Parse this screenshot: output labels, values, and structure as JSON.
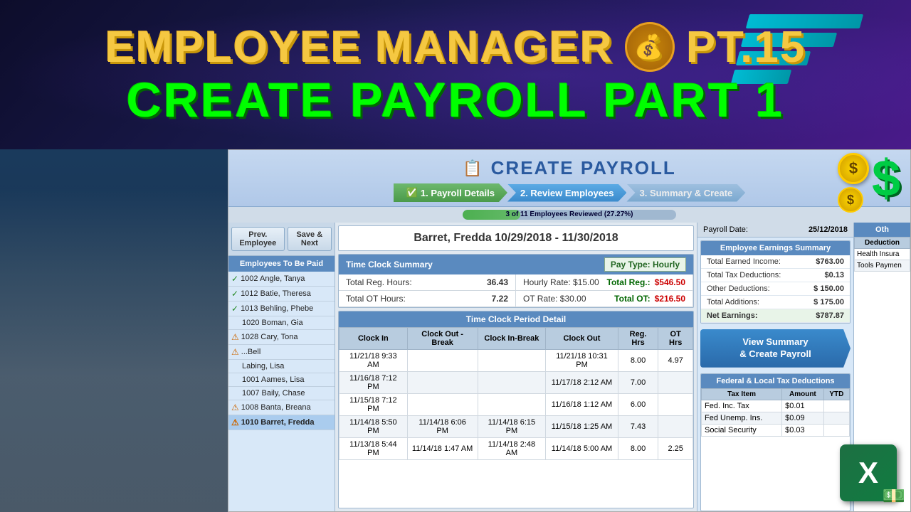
{
  "header": {
    "title_line1": "EMPLOYEE MANAGER",
    "title_pt": "PT.15",
    "title_line2": "CREATE PAYROLL PART 1"
  },
  "app": {
    "title": "CREATE PAYROLL",
    "steps": [
      {
        "label": "1. Payroll Details",
        "state": "completed"
      },
      {
        "label": "2. Review Employees",
        "state": "active"
      },
      {
        "label": "3. Summary & Create",
        "state": "inactive"
      }
    ],
    "progress": {
      "text": "3 of 11 Employees Reviewed (27.27%)",
      "percent": 27
    },
    "nav": {
      "prev_btn": "Prev. Employee",
      "next_btn": "Save & Next"
    },
    "current_employee": {
      "header": "Barret, Fredda  10/29/2018 - 11/30/2018"
    },
    "employees_panel_title": "Employees To Be Paid",
    "employees": [
      {
        "id": "1002",
        "name": "Angle, Tanya",
        "status": "check"
      },
      {
        "id": "1012",
        "name": "Batie, Theresa",
        "status": "check"
      },
      {
        "id": "1013",
        "name": "Behling, Phebe",
        "status": "check"
      },
      {
        "id": "1020",
        "name": "Boman, Gia",
        "status": "none"
      },
      {
        "id": "1028",
        "name": "Cary, Tona",
        "status": "warn"
      },
      {
        "id": "",
        "name": "...Bell",
        "status": "warn"
      },
      {
        "id": "",
        "name": "Labing, Lisa",
        "status": "none"
      },
      {
        "id": "1001",
        "name": "Aames, Lisa",
        "status": "none"
      },
      {
        "id": "1007",
        "name": "Baily, Chase",
        "status": "none"
      },
      {
        "id": "1008",
        "name": "Banta, Breana",
        "status": "warn"
      },
      {
        "id": "1010",
        "name": "Barret, Fredda",
        "status": "warn",
        "selected": true
      }
    ],
    "payroll_date_label": "Payroll Date:",
    "payroll_date_value": "25/12/2018",
    "earnings_summary": {
      "title": "Employee Earnings Summary",
      "rows": [
        {
          "label": "Total Earned Income:",
          "value": "$763.00"
        },
        {
          "label": "Total Tax Deductions:",
          "value": "$0.13"
        },
        {
          "label": "Other Deductions:",
          "value": "$  150.00"
        },
        {
          "label": "Total Additions:",
          "value": "$  175.00"
        },
        {
          "label": "Net Earnings:",
          "value": "$787.87"
        }
      ]
    },
    "view_summary_btn": "View Summary\n& Create Payroll",
    "time_clock_summary": {
      "title": "Time Clock Summary",
      "pay_type": "Pay Type: Hourly",
      "rows": [
        {
          "label": "Total Reg. Hours:",
          "value": "36.43",
          "right_label": "Hourly Rate:",
          "right_value": "$15.00",
          "total_label": "Total Reg.:",
          "total_value": "$546.50"
        },
        {
          "label": "Total OT Hours:",
          "value": "7.22",
          "right_label": "OT Rate:",
          "right_value": "$30.00",
          "total_label": "Total OT:",
          "total_value": "$216.50"
        }
      ]
    },
    "period_detail": {
      "title": "Time Clock Period Detail",
      "columns": [
        "Clock In",
        "Clock Out -Break",
        "Clock In-Break",
        "Clock Out",
        "Reg. Hrs",
        "OT Hrs"
      ],
      "rows": [
        {
          "clock_in": "11/21/18 9:33 AM",
          "clock_out_break": "",
          "clock_in_break": "",
          "clock_out": "11/21/18 10:31 PM",
          "reg_hrs": "8.00",
          "ot_hrs": "4.97"
        },
        {
          "clock_in": "11/16/18 7:12 PM",
          "clock_out_break": "",
          "clock_in_break": "",
          "clock_out": "11/17/18 2:12 AM",
          "reg_hrs": "7.00",
          "ot_hrs": ""
        },
        {
          "clock_in": "11/15/18 7:12 PM",
          "clock_out_break": "",
          "clock_in_break": "",
          "clock_out": "11/16/18 1:12 AM",
          "reg_hrs": "6.00",
          "ot_hrs": ""
        },
        {
          "clock_in": "11/14/18 5:50 PM",
          "clock_out_break": "11/14/18 6:06 PM",
          "clock_in_break": "11/14/18 6:15 PM",
          "clock_out": "11/15/18 1:25 AM",
          "reg_hrs": "7.43",
          "ot_hrs": ""
        },
        {
          "clock_in": "11/13/18 5:44 PM",
          "clock_out_break": "11/14/18 1:47 AM",
          "clock_in_break": "11/14/18 2:48 AM",
          "clock_out": "11/14/18 5:00 AM",
          "reg_hrs": "8.00",
          "ot_hrs": "2.25"
        }
      ]
    },
    "tax_deductions": {
      "title": "Federal & Local Tax Deductions",
      "columns": [
        "Tax Item",
        "Amount",
        "YTD"
      ],
      "rows": [
        {
          "item": "Fed. Inc. Tax",
          "amount": "$0.01",
          "ytd": ""
        },
        {
          "item": "Fed Unemp. Ins.",
          "amount": "$0.09",
          "ytd": ""
        },
        {
          "item": "Social Security",
          "amount": "$0.03",
          "ytd": ""
        }
      ]
    },
    "other_deductions_header": "Oth",
    "other_deductions_col": "Deduction",
    "other_rows": [
      {
        "item": "Health Insura"
      },
      {
        "item": "Tools Paymen"
      }
    ]
  }
}
